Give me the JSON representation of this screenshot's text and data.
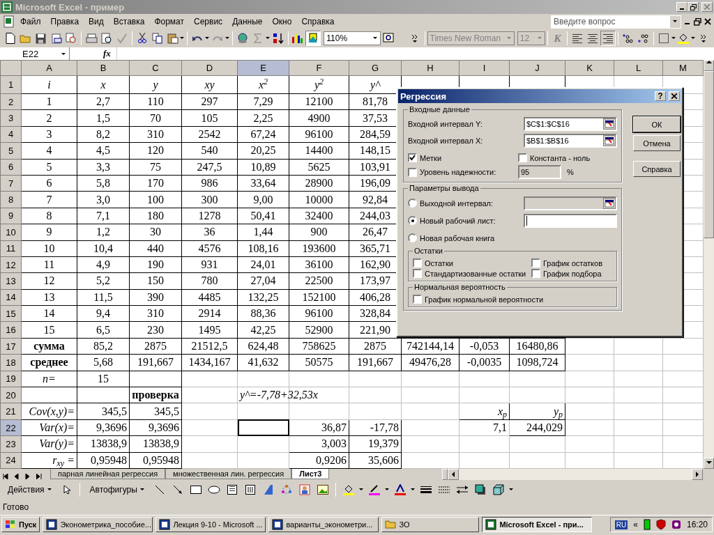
{
  "window": {
    "title": "Microsoft Excel - пример"
  },
  "menu": {
    "items": [
      "Файл",
      "Правка",
      "Вид",
      "Вставка",
      "Формат",
      "Сервис",
      "Данные",
      "Окно",
      "Справка"
    ],
    "help_search": {
      "placeholder": "Введите вопрос"
    }
  },
  "toolbar": {
    "zoom": "110%",
    "font": "Times New Roman",
    "font_size": "12",
    "italic_button": "K"
  },
  "formula_bar": {
    "cell": "E22",
    "function_button": "fx"
  },
  "sheet": {
    "columns": [
      {
        "label": "A",
        "selected": false
      },
      {
        "label": "B",
        "selected": false
      },
      {
        "label": "C",
        "selected": false
      },
      {
        "label": "D",
        "selected": false
      },
      {
        "label": "E",
        "selected": true
      },
      {
        "label": "F",
        "selected": false
      },
      {
        "label": "G",
        "selected": false
      },
      {
        "label": "H",
        "selected": false
      },
      {
        "label": "I",
        "selected": false
      },
      {
        "label": "J",
        "selected": false
      },
      {
        "label": "K",
        "selected": false
      },
      {
        "label": "L",
        "selected": false
      },
      {
        "label": "M",
        "selected": false
      }
    ],
    "rows": [
      {
        "label": "1",
        "selected": false,
        "cells": [
          {
            "t": "i",
            "kind": "heading"
          },
          {
            "t": "x",
            "kind": "heading"
          },
          {
            "t": "y",
            "kind": "heading"
          },
          {
            "t": "xy",
            "kind": "heading"
          },
          {
            "t": "x$^{2}$",
            "kind": "heading"
          },
          {
            "t": "y$^{2}$",
            "kind": "heading"
          },
          {
            "t": "y^",
            "kind": "heading"
          }
        ]
      },
      {
        "label": "2",
        "selected": false,
        "cells": [
          {
            "t": "1"
          },
          {
            "t": "2,7"
          },
          {
            "t": "110"
          },
          {
            "t": "297"
          },
          {
            "t": "7,29"
          },
          {
            "t": "12100"
          },
          {
            "t": "81,78"
          }
        ]
      },
      {
        "label": "3",
        "selected": false,
        "cells": [
          {
            "t": "2"
          },
          {
            "t": "1,5"
          },
          {
            "t": "70"
          },
          {
            "t": "105"
          },
          {
            "t": "2,25"
          },
          {
            "t": "4900"
          },
          {
            "t": "37,53"
          }
        ]
      },
      {
        "label": "4",
        "selected": false,
        "cells": [
          {
            "t": "3"
          },
          {
            "t": "8,2"
          },
          {
            "t": "310"
          },
          {
            "t": "2542"
          },
          {
            "t": "67,24"
          },
          {
            "t": "96100"
          },
          {
            "t": "284,59"
          }
        ]
      },
      {
        "label": "5",
        "selected": false,
        "cells": [
          {
            "t": "4"
          },
          {
            "t": "4,5"
          },
          {
            "t": "120"
          },
          {
            "t": "540"
          },
          {
            "t": "20,25"
          },
          {
            "t": "14400"
          },
          {
            "t": "148,15"
          }
        ]
      },
      {
        "label": "6",
        "selected": false,
        "cells": [
          {
            "t": "5"
          },
          {
            "t": "3,3"
          },
          {
            "t": "75"
          },
          {
            "t": "247,5"
          },
          {
            "t": "10,89"
          },
          {
            "t": "5625"
          },
          {
            "t": "103,91"
          }
        ]
      },
      {
        "label": "7",
        "selected": false,
        "cells": [
          {
            "t": "6"
          },
          {
            "t": "5,8"
          },
          {
            "t": "170"
          },
          {
            "t": "986"
          },
          {
            "t": "33,64"
          },
          {
            "t": "28900"
          },
          {
            "t": "196,09"
          }
        ]
      },
      {
        "label": "8",
        "selected": false,
        "cells": [
          {
            "t": "7"
          },
          {
            "t": "3,0"
          },
          {
            "t": "100"
          },
          {
            "t": "300"
          },
          {
            "t": "9,00"
          },
          {
            "t": "10000"
          },
          {
            "t": "92,84"
          }
        ]
      },
      {
        "label": "9",
        "selected": false,
        "cells": [
          {
            "t": "8"
          },
          {
            "t": "7,1"
          },
          {
            "t": "180"
          },
          {
            "t": "1278"
          },
          {
            "t": "50,41"
          },
          {
            "t": "32400"
          },
          {
            "t": "244,03"
          }
        ]
      },
      {
        "label": "10",
        "selected": false,
        "cells": [
          {
            "t": "9"
          },
          {
            "t": "1,2"
          },
          {
            "t": "30"
          },
          {
            "t": "36"
          },
          {
            "t": "1,44"
          },
          {
            "t": "900"
          },
          {
            "t": "26,47"
          }
        ]
      },
      {
        "label": "11",
        "selected": false,
        "cells": [
          {
            "t": "10"
          },
          {
            "t": "10,4"
          },
          {
            "t": "440"
          },
          {
            "t": "4576"
          },
          {
            "t": "108,16"
          },
          {
            "t": "193600"
          },
          {
            "t": "365,71"
          }
        ]
      },
      {
        "label": "12",
        "selected": false,
        "cells": [
          {
            "t": "11"
          },
          {
            "t": "4,9"
          },
          {
            "t": "190"
          },
          {
            "t": "931"
          },
          {
            "t": "24,01"
          },
          {
            "t": "36100"
          },
          {
            "t": "162,90"
          }
        ]
      },
      {
        "label": "13",
        "selected": false,
        "cells": [
          {
            "t": "12"
          },
          {
            "t": "5,2"
          },
          {
            "t": "150"
          },
          {
            "t": "780"
          },
          {
            "t": "27,04"
          },
          {
            "t": "22500"
          },
          {
            "t": "173,97"
          }
        ]
      },
      {
        "label": "14",
        "selected": false,
        "cells": [
          {
            "t": "13"
          },
          {
            "t": "11,5"
          },
          {
            "t": "390"
          },
          {
            "t": "4485"
          },
          {
            "t": "132,25"
          },
          {
            "t": "152100"
          },
          {
            "t": "406,28"
          }
        ]
      },
      {
        "label": "15",
        "selected": false,
        "cells": [
          {
            "t": "14"
          },
          {
            "t": "9,4"
          },
          {
            "t": "310"
          },
          {
            "t": "2914"
          },
          {
            "t": "88,36"
          },
          {
            "t": "96100"
          },
          {
            "t": "328,84"
          }
        ]
      },
      {
        "label": "16",
        "selected": false,
        "cells": [
          {
            "t": "15"
          },
          {
            "t": "6,5"
          },
          {
            "t": "230"
          },
          {
            "t": "1495"
          },
          {
            "t": "42,25"
          },
          {
            "t": "52900"
          },
          {
            "t": "221,90"
          }
        ]
      },
      {
        "label": "17",
        "selected": false,
        "cells": [
          {
            "t": "сумма",
            "kind": "total"
          },
          {
            "t": "85,2"
          },
          {
            "t": "2875"
          },
          {
            "t": "21512,5"
          },
          {
            "t": "624,48"
          },
          {
            "t": "758625"
          },
          {
            "t": "2875"
          },
          {
            "t": "742144,14"
          },
          {
            "t": "-0,053"
          },
          {
            "t": "16480,86"
          }
        ]
      },
      {
        "label": "18",
        "selected": false,
        "cells": [
          {
            "t": "среднее",
            "kind": "total"
          },
          {
            "t": "5,68"
          },
          {
            "t": "191,667"
          },
          {
            "t": "1434,167"
          },
          {
            "t": "41,632"
          },
          {
            "t": "50575"
          },
          {
            "t": "191,667"
          },
          {
            "t": "49476,28"
          },
          {
            "t": "-0,0035"
          },
          {
            "t": "1098,724"
          }
        ]
      },
      {
        "label": "19",
        "selected": false,
        "cells": [
          {
            "t": "n=",
            "kind": "heading"
          },
          {
            "t": "15"
          }
        ]
      },
      {
        "label": "20",
        "selected": false,
        "cells": [
          {},
          {},
          {
            "t": "проверка",
            "kind": "total"
          },
          {},
          {
            "t": "y^=-7,78+32,53x",
            "kind": "note"
          }
        ]
      },
      {
        "label": "21",
        "selected": false,
        "cells": [
          {
            "t": "Cov(x,y)=",
            "kind": "name"
          },
          {
            "t": "345,5",
            "kind": "value"
          },
          {
            "t": "345,5",
            "kind": "value"
          },
          {},
          {},
          {},
          {},
          {},
          {
            "t": "x$_{p}$",
            "kind": "name"
          },
          {
            "t": "y$_{p}$",
            "kind": "name"
          }
        ]
      },
      {
        "label": "22",
        "selected": true,
        "cells": [
          {
            "t": "Var(x)=",
            "kind": "name"
          },
          {
            "t": "9,3696",
            "kind": "value"
          },
          {
            "t": "9,3696",
            "kind": "value"
          },
          {},
          {
            "selected": true
          },
          {
            "t": "36,87",
            "kind": "value"
          },
          {
            "t": "-17,78",
            "kind": "value"
          },
          {},
          {
            "t": "7,1",
            "kind": "value"
          },
          {
            "t": "244,029",
            "kind": "value"
          }
        ]
      },
      {
        "label": "23",
        "selected": false,
        "cells": [
          {
            "t": "Var(y)=",
            "kind": "name"
          },
          {
            "t": "13838,9",
            "kind": "value"
          },
          {
            "t": "13838,9",
            "kind": "value"
          },
          {},
          {},
          {
            "t": "3,003",
            "kind": "value"
          },
          {
            "t": "19,379",
            "kind": "value"
          }
        ]
      },
      {
        "label": "24",
        "selected": false,
        "cells": [
          {
            "t": "r$_{xy}$ =",
            "kind": "name"
          },
          {
            "t": "0,95948",
            "kind": "value"
          },
          {
            "t": "0,95948",
            "kind": "value"
          },
          {},
          {},
          {
            "t": "0,9206",
            "kind": "value"
          },
          {
            "t": "35,606",
            "kind": "value"
          }
        ]
      }
    ]
  },
  "sheet_tabs": [
    {
      "label": "парная линейная регрессия",
      "selected": false
    },
    {
      "label": "множественная лин. регрессия",
      "selected": false
    },
    {
      "label": "Лист3",
      "selected": true
    }
  ],
  "drawing_toolbar": {
    "actions": "Действия",
    "autoshapes": "Автофигуры"
  },
  "status_bar": {
    "text": "Готово"
  },
  "taskbar": {
    "start": "Пуск",
    "tasks": [
      {
        "label": "Эконометрика_пособие...",
        "kind": "document",
        "selected": false
      },
      {
        "label": "Лекция 9-10 - Microsoft ...",
        "kind": "document",
        "selected": false
      },
      {
        "label": "варианты_эконометри...",
        "kind": "document",
        "selected": false
      },
      {
        "label": "ЗО",
        "kind": "folder",
        "selected": false
      },
      {
        "label": "Microsoft Excel - при...",
        "kind": "spreadsheet",
        "selected": true
      }
    ],
    "language": "RU",
    "tray_expand": "«",
    "clock": "16:20"
  },
  "dialog": {
    "title": "Регрессия",
    "help_button": "?",
    "input_group": {
      "title": "Входные данные",
      "fields": [
        {
          "label": "Входной интервал Y:",
          "value": "$C$1:$C$16"
        },
        {
          "label": "Входной интервал X:",
          "value": "$B$1:$B$16"
        }
      ],
      "checks": [
        {
          "label": "Метки",
          "checked": true
        },
        {
          "label": "Константа - ноль",
          "checked": false
        }
      ],
      "confidence": {
        "label": "Уровень надежности:",
        "checked": false,
        "value": "95",
        "unit": "%"
      }
    },
    "output_group": {
      "title": "Параметры вывода",
      "options": [
        {
          "label": "Выходной интервал:",
          "selected": false,
          "kind": "range"
        },
        {
          "label": "Новый рабочий лист:",
          "selected": true,
          "kind": "text"
        },
        {
          "label": "Новая рабочая книга",
          "selected": false,
          "kind": "plain"
        }
      ],
      "residuals": {
        "title": "Остатки",
        "checks": [
          {
            "label": "Остатки",
            "checked": false
          },
          {
            "label": "График остатков",
            "checked": false
          },
          {
            "label": "Стандартизованные остатки",
            "checked": false
          },
          {
            "label": "График подбора",
            "checked": false
          }
        ]
      },
      "normal": {
        "title": "Нормальная вероятность",
        "checks": [
          {
            "label": "График нормальной вероятности",
            "checked": false
          }
        ]
      }
    },
    "buttons": [
      "ОК",
      "Отмена",
      "Справка"
    ]
  }
}
